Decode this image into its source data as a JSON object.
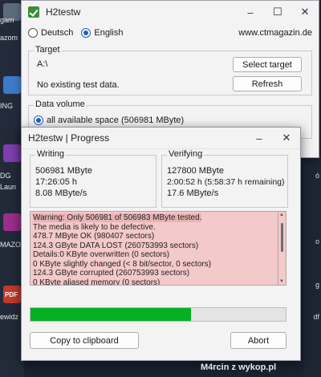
{
  "desktop": {
    "items": [
      "gam",
      "azom",
      "ING",
      "DG",
      "Laun",
      "MAZO",
      "PDF",
      "ewidz"
    ],
    "right_items": [
      "ó",
      "o",
      "g",
      "df"
    ]
  },
  "main_window": {
    "title": "H2testw",
    "language_options": [
      {
        "label": "Deutsch",
        "selected": false
      },
      {
        "label": "English",
        "selected": true
      }
    ],
    "website": "www.ctmagazin.de",
    "target": {
      "group_title": "Target",
      "path": "A:\\",
      "status": "No existing test data.",
      "select_button": "Select target",
      "refresh_button": "Refresh"
    },
    "data_volume": {
      "group_title": "Data volume",
      "option_label": "all available space (506981 MByte)"
    }
  },
  "progress_dialog": {
    "title": "H2testw | Progress",
    "writing": {
      "title": "Writing",
      "size": "506981 MByte",
      "time": "17:26:05 h",
      "speed": "8.08 MByte/s"
    },
    "verifying": {
      "title": "Verifying",
      "size": "127800 MByte",
      "time": "2:00:52 h (5:58:37 h remaining)",
      "speed": "17.6 MByte/s"
    },
    "log_lines": [
      "Warning: Only 506981 of 506983 MByte tested.",
      "The media is likely to be defective.",
      "478.7 MByte OK (980407 sectors)",
      "124.3 GByte DATA LOST (260753993 sectors)",
      "Details:0 KByte overwritten (0 sectors)",
      "0 KByte slightly changed (< 8 bit/sector, 0 sectors)",
      "124.3 GByte corrupted (260753993 sectors)",
      "0 KByte aliased memory (0 sectors)"
    ],
    "progress_fraction": 0.63,
    "progress_color": "#06b025",
    "log_background": "#f4c9c9",
    "copy_button": "Copy to clipboard",
    "abort_button": "Abort"
  },
  "watermark": "M4rcin z wykop.pl"
}
